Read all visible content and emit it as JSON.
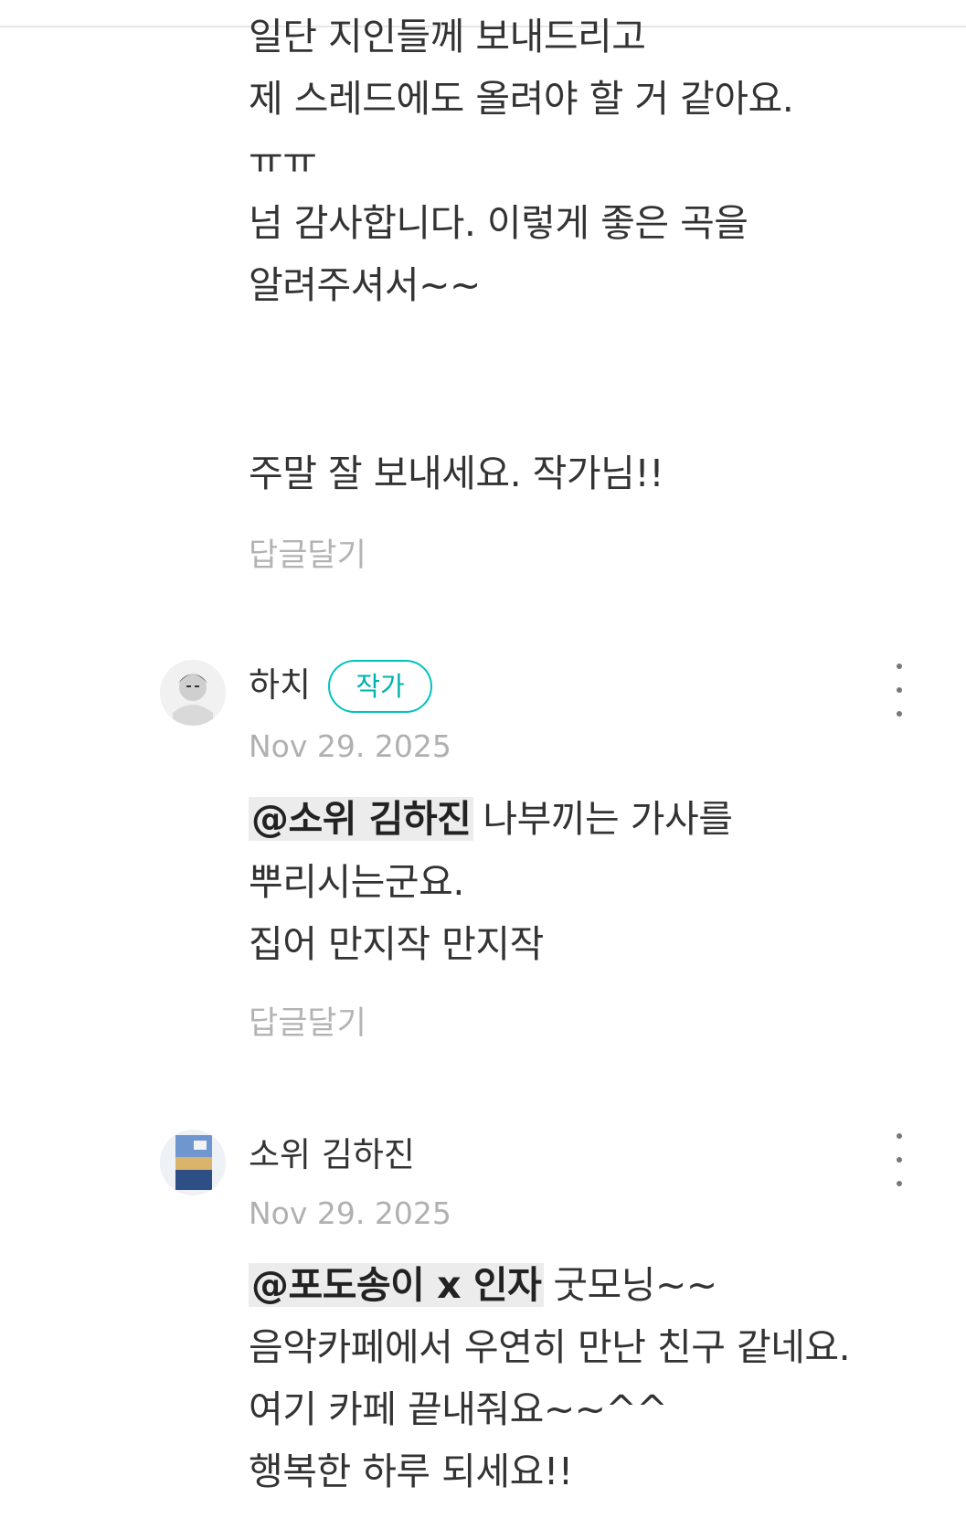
{
  "comment_1": {
    "lines": [
      "일단 지인들께 보내드리고",
      "제 스레드에도 올려야 할 거 같아요.",
      "ㅠㅠ",
      "넘 감사합니다. 이렇게 좋은 곡을",
      "알려주셔서~~",
      "주말 잘 보내세요. 작가님!!"
    ],
    "reply_label": "답글달기"
  },
  "comment_2": {
    "author": "하치",
    "author_badge": "작가",
    "date": "Nov 29. 2025",
    "mention": "@소위 김하진",
    "lines": [
      "나부끼는 가사를",
      "뿌리시는군요.",
      "집어 만지작 만지작"
    ],
    "reply_label": "답글달기"
  },
  "comment_3": {
    "author": "소위 김하진",
    "date": "Nov 29. 2025",
    "mention": "@포도송이 x 인자",
    "lines": [
      "굿모닝~~",
      "음악카페에서 우연히 만난 친구 같네요.",
      "여기 카페 끝내줘요~~^^",
      "행복한 하루 되세요!!"
    ]
  },
  "icons": {
    "more": "more-vertical-icon"
  },
  "colors": {
    "text": "#333333",
    "muted": "#b0b0b0",
    "badge": "#00c3bd",
    "mention_bg": "#ececec"
  }
}
